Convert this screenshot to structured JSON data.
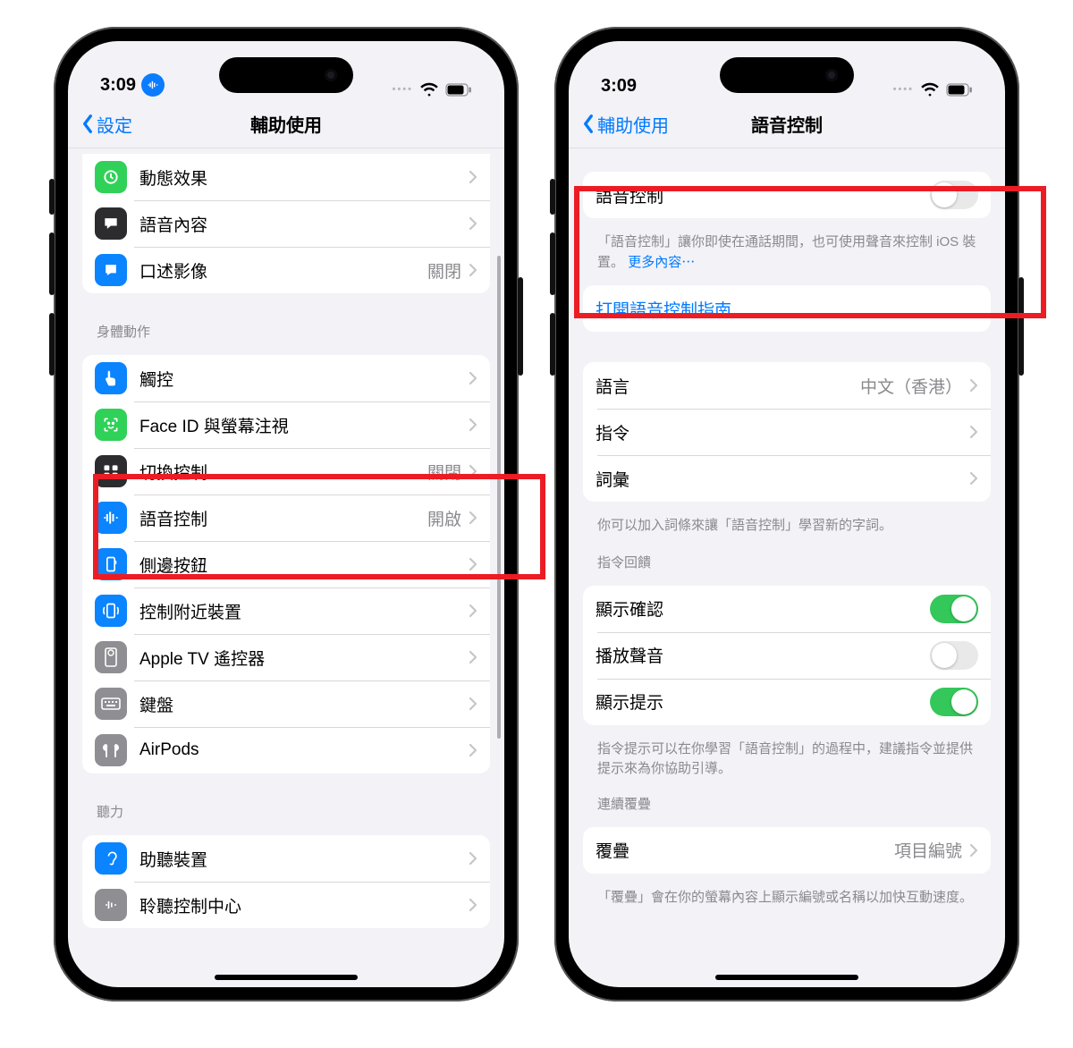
{
  "status": {
    "time": "3:09"
  },
  "left": {
    "nav_back": "設定",
    "nav_title": "輔助使用",
    "rows": {
      "motion": "動態效果",
      "speech": "語音內容",
      "audio_desc": "口述影像",
      "audio_desc_val": "關閉"
    },
    "section_body": "身體動作",
    "body": {
      "touch": "觸控",
      "faceid": "Face ID 與螢幕注視",
      "switch": "切換控制",
      "switch_val": "關閉",
      "voice": "語音控制",
      "voice_val": "開啟",
      "side": "側邊按鈕",
      "nearby": "控制附近裝置",
      "appletv": "Apple TV 遙控器",
      "keyboard": "鍵盤",
      "airpods": "AirPods"
    },
    "section_hearing": "聽力",
    "hearing": {
      "devices": "助聽裝置",
      "center": "聆聽控制中心"
    }
  },
  "right": {
    "nav_back": "輔助使用",
    "nav_title": "語音控制",
    "toggle_label": "語音控制",
    "footer1a": "「語音控制」讓你即使在通話期間，也可使用聲音來控制 iOS 裝置。",
    "footer1_more": "更多內容⋯",
    "guide": "打開語音控制指南",
    "lang": "語言",
    "lang_val": "中文（香港）",
    "commands": "指令",
    "vocab": "詞彙",
    "footer2": "你可以加入詞條來讓「語音控制」學習新的字詞。",
    "section_feedback": "指令回饋",
    "show_confirm": "顯示確認",
    "play_sound": "播放聲音",
    "show_hint": "顯示提示",
    "footer3": "指令提示可以在你學習「語音控制」的過程中，建議指令並提供提示來為你協助引導。",
    "section_overlay": "連續覆疊",
    "overlay": "覆疊",
    "overlay_val": "項目編號",
    "footer4": "「覆疊」會在你的螢幕內容上顯示編號或名稱以加快互動速度。"
  }
}
